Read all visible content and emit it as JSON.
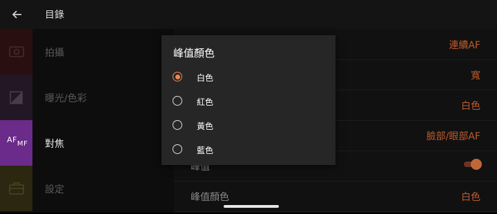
{
  "header": {
    "title": "目錄",
    "back_icon": "arrow-left-icon"
  },
  "sidebar": {
    "items": [
      {
        "label": "拍攝",
        "icon": "camera-icon"
      },
      {
        "label": "曝光/色彩",
        "icon": "exposure-icon"
      },
      {
        "label": "對焦",
        "icon": "af-mf-icon",
        "icon_text": [
          "AF",
          "MF"
        ]
      },
      {
        "label": "設定",
        "icon": "toolbox-icon"
      }
    ]
  },
  "settings": {
    "rows": [
      {
        "label": "",
        "value": "連續AF"
      },
      {
        "label": "",
        "value": "寬"
      },
      {
        "label": "",
        "value": "白色"
      },
      {
        "label": "",
        "value": "臉部/眼部AF"
      },
      {
        "label": "峰值",
        "value": ""
      },
      {
        "label": "峰值顏色",
        "value": "白色"
      }
    ]
  },
  "dialog": {
    "title": "峰值顏色",
    "options": [
      {
        "label": "白色",
        "selected": true
      },
      {
        "label": "紅色",
        "selected": false
      },
      {
        "label": "黃色",
        "selected": false
      },
      {
        "label": "藍色",
        "selected": false
      }
    ]
  },
  "colors": {
    "accent": "#f08850",
    "value_text": "#c05a2c",
    "active_tab": "#6a2b8a"
  }
}
